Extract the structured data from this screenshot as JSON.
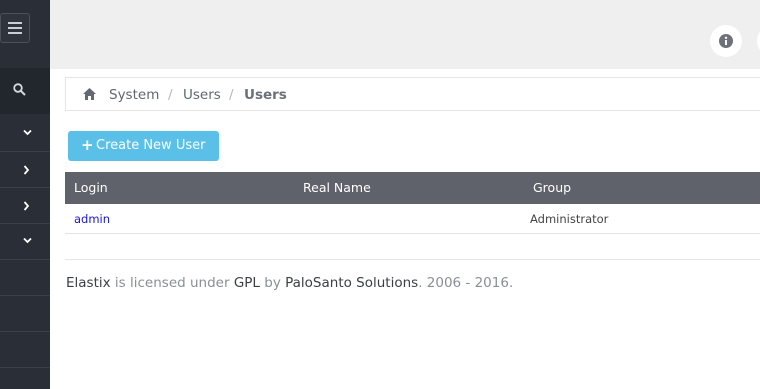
{
  "sidebar": {
    "menu_icon": "hamburger-icon",
    "search_icon": "search-icon",
    "items": [
      {
        "icon": "chevron-down-icon"
      },
      {
        "icon": "chevron-right-icon"
      },
      {
        "icon": "chevron-right-icon"
      },
      {
        "icon": "chevron-down-icon"
      }
    ]
  },
  "topbar": {
    "info_icon": "info-icon"
  },
  "breadcrumb": {
    "items": [
      "System",
      "Users",
      "Users"
    ],
    "separator": "/"
  },
  "actions": {
    "create_user": "Create New User",
    "create_icon": "+"
  },
  "table": {
    "columns": [
      "Login",
      "Real Name",
      "Group"
    ],
    "rows": [
      {
        "login": "admin",
        "real_name": "",
        "group": "Administrator"
      }
    ]
  },
  "footer": {
    "product": "Elastix",
    "text1": "is licensed under",
    "license": "GPL",
    "text2": "by",
    "company": "PaloSanto Solutions",
    "years": ". 2006 - 2016."
  },
  "colors": {
    "sidebar": "#2a2f37",
    "primary_button": "#5bc0e8",
    "table_header": "#5f626b",
    "link": "#1a1acc"
  }
}
